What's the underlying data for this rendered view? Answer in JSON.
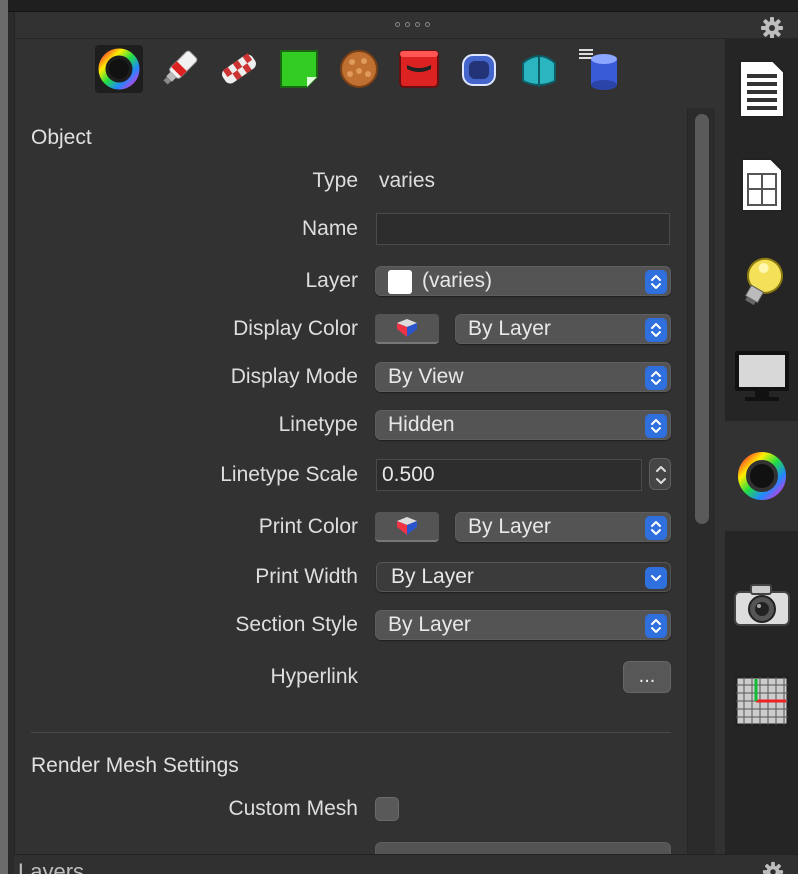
{
  "toolbar": {
    "items": [
      {
        "name": "object-properties-icon",
        "active": true
      },
      {
        "name": "material-icon"
      },
      {
        "name": "texture-mapping-icon"
      },
      {
        "name": "decal-icon"
      },
      {
        "name": "displacement-icon"
      },
      {
        "name": "shadows-icon"
      },
      {
        "name": "edge-softening-icon"
      },
      {
        "name": "shut-lining-icon"
      },
      {
        "name": "curve-piping-icon"
      }
    ]
  },
  "object_section": {
    "title": "Object",
    "type_label": "Type",
    "type_value": "varies",
    "name_label": "Name",
    "name_value": "",
    "layer_label": "Layer",
    "layer_value": "(varies)",
    "display_color_label": "Display Color",
    "display_color_value": "By Layer",
    "display_mode_label": "Display Mode",
    "display_mode_value": "By View",
    "linetype_label": "Linetype",
    "linetype_value": "Hidden",
    "linetype_scale_label": "Linetype Scale",
    "linetype_scale_value": "0.500",
    "print_color_label": "Print Color",
    "print_color_value": "By Layer",
    "print_width_label": "Print Width",
    "print_width_value": "By Layer",
    "section_style_label": "Section Style",
    "section_style_value": "By Layer",
    "hyperlink_label": "Hyperlink",
    "hyperlink_button": "..."
  },
  "render_mesh": {
    "title": "Render Mesh Settings",
    "custom_mesh_label": "Custom Mesh",
    "custom_mesh_checked": false
  },
  "sidebar": {
    "items": [
      {
        "name": "document-properties-icon"
      },
      {
        "name": "layouts-icon"
      },
      {
        "name": "lights-icon"
      },
      {
        "name": "display-icon"
      },
      {
        "name": "properties-icon",
        "active": true
      },
      {
        "name": "named-views-icon"
      },
      {
        "name": "named-cplanes-icon"
      }
    ]
  },
  "bottom_panel": {
    "title": "Layers"
  },
  "colors": {
    "accent": "#2f6fde",
    "panel_bg": "#323232",
    "sidebar_bg": "#252525",
    "popup_bg": "#545454"
  }
}
